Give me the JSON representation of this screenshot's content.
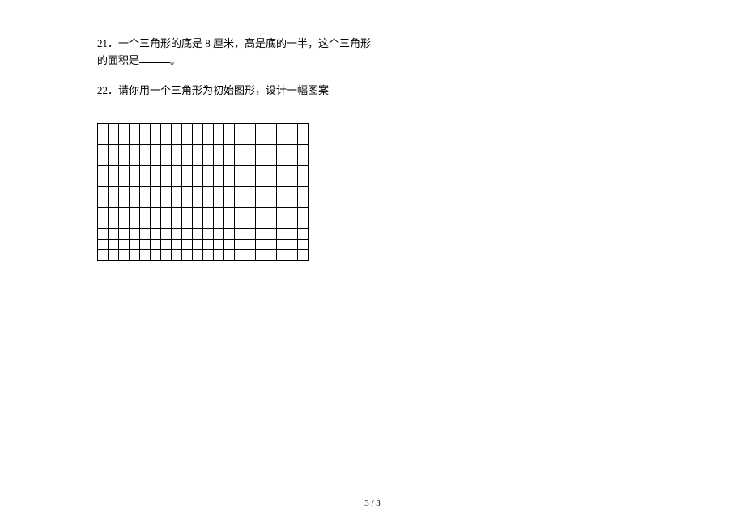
{
  "questions": {
    "q21": {
      "number": "21．",
      "text_before": "一个三角形的底是 8 厘米，高是底的一半，这个三角形的面积是",
      "text_after": "。"
    },
    "q22": {
      "number": "22．",
      "text": "请你用一个三角形为初始图形，设计一幅图案"
    }
  },
  "grid": {
    "cols": 20,
    "rows": 13
  },
  "footer": {
    "page": "3 / 3"
  }
}
